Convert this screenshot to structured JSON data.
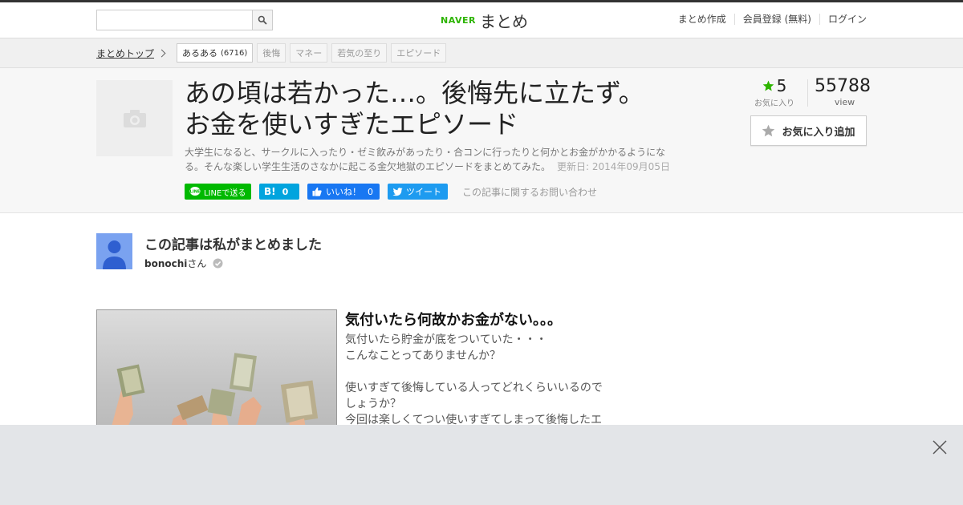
{
  "header": {
    "search_placeholder": "",
    "logo_brand": "NAVER",
    "logo_name": "まとめ",
    "nav": [
      "まとめ作成",
      "会員登録 (無料)",
      "ログイン"
    ]
  },
  "breadcrumb": {
    "top_label": "まとめトップ"
  },
  "tags": [
    {
      "label": "あるある",
      "count": "(6716)"
    },
    {
      "label": "後悔"
    },
    {
      "label": "マネー"
    },
    {
      "label": "若気の至り"
    },
    {
      "label": "エピソード"
    }
  ],
  "article": {
    "title_line1": "あの頃は若かった…。後悔先に立たず。",
    "title_line2": "お金を使いすぎたエピソード",
    "description": "大学生になると、サークルに入ったり・ゼミ飲みがあったり・合コンに行ったりと何かとお金がかかるようになる。そんな楽しい学生生活のさなかに起こる金欠地獄のエピソードをまとめてみた。",
    "updated": "更新日: 2014年09月05日",
    "favorites_count": "5",
    "favorites_label": "お気に入り",
    "views_count": "55788",
    "views_label": "view",
    "favorite_button": "お気に入り追加"
  },
  "share": {
    "line": "LINEで送る",
    "hatena_icon": "B!",
    "hatena_count": "0",
    "facebook": "いいね！",
    "facebook_count": "0",
    "twitter": "ツイート",
    "inquiry": "この記事に関するお問い合わせ"
  },
  "author": {
    "heading": "この記事は私がまとめました",
    "name": "bonochi",
    "suffix": "さん"
  },
  "item": {
    "title": "気付いたら何故かお金がない。。。",
    "lines": [
      "気付いたら貯金が底をついていた・・・",
      "こんなことってありませんか？",
      "",
      "使いすぎて後悔している人ってどれくらいいるので",
      "しょうか？",
      "今回は楽しくてつい使いすぎてしまって後悔したエ"
    ]
  },
  "colors": {
    "brand_green": "#2db400",
    "line_green": "#00b900",
    "hatena_blue": "#00a4de",
    "facebook_blue": "#1877f2",
    "twitter_blue": "#1d9bf0",
    "star_green": "#2db400"
  }
}
